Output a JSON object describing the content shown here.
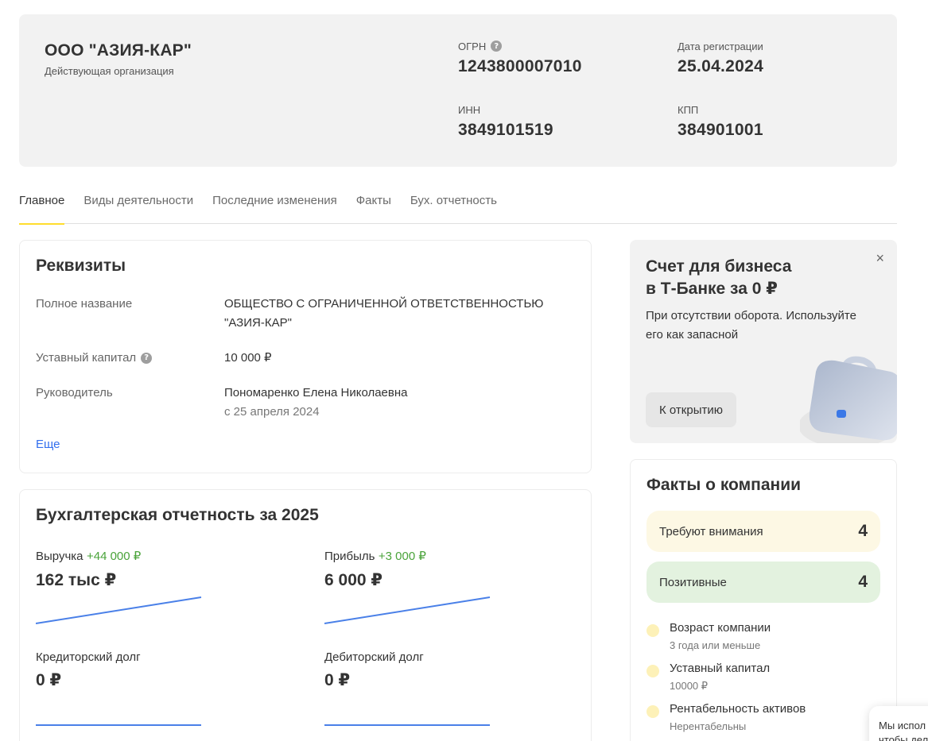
{
  "header": {
    "company_name": "ООО \"АЗИЯ-КАР\"",
    "status": "Действующая организация",
    "ogrn_label": "ОГРН",
    "ogrn_value": "1243800007010",
    "reg_date_label": "Дата регистрации",
    "reg_date_value": "25.04.2024",
    "inn_label": "ИНН",
    "inn_value": "3849101519",
    "kpp_label": "КПП",
    "kpp_value": "384901001"
  },
  "tabs": [
    {
      "label": "Главное",
      "active": true
    },
    {
      "label": "Виды деятельности",
      "active": false
    },
    {
      "label": "Последние изменения",
      "active": false
    },
    {
      "label": "Факты",
      "active": false
    },
    {
      "label": "Бух. отчетность",
      "active": false
    }
  ],
  "requisites": {
    "title": "Реквизиты",
    "full_name_label": "Полное название",
    "full_name_value": "ОБЩЕСТВО С ОГРАНИЧЕННОЙ ОТВЕТСТВЕННОСТЬЮ \"АЗИЯ-КАР\"",
    "capital_label": "Уставный капитал",
    "capital_value": "10 000 ₽",
    "head_label": "Руководитель",
    "head_value": "Пономаренко Елена Николаевна",
    "head_since": "с 25 апреля 2024",
    "more_link": "Еще"
  },
  "accounting": {
    "title": "Бухгалтерская отчетность за 2025",
    "metrics": [
      {
        "label": "Выручка",
        "delta": "+44 000 ₽",
        "value": "162 тыс ₽",
        "trend": "up"
      },
      {
        "label": "Прибыль",
        "delta": "+3 000 ₽",
        "value": "6 000 ₽",
        "trend": "up"
      },
      {
        "label": "Кредиторский долг",
        "delta": "",
        "value": "0 ₽",
        "trend": "flat"
      },
      {
        "label": "Дебиторский долг",
        "delta": "",
        "value": "0 ₽",
        "trend": "flat"
      }
    ],
    "line_color": "#4a80e8"
  },
  "promo": {
    "title_line1": "Счет для бизнеса",
    "title_line2": "в Т-Банке за 0 ₽",
    "text": "При отсутствии оборота. Используйте его как запасной",
    "button": "К открытию",
    "close": "×"
  },
  "facts": {
    "title": "Факты о компании",
    "attention_label": "Требуют внимания",
    "attention_count": "4",
    "positive_label": "Позитивные",
    "positive_count": "4",
    "items": [
      {
        "title": "Возраст компании",
        "sub": "3 года или меньше"
      },
      {
        "title": "Уставный капитал",
        "sub": "10000 ₽"
      },
      {
        "title": "Рентабельность активов",
        "sub": "Нерентабельны"
      }
    ]
  },
  "cookie": {
    "text_line1": "Мы испол",
    "text_line2": "чтобы дел"
  },
  "colors": {
    "accent": "#ffdd2d",
    "attention_bg": "#fdf8e4",
    "positive_bg": "#e3f2df",
    "link": "#336fee",
    "delta_green": "#4aa33a"
  }
}
